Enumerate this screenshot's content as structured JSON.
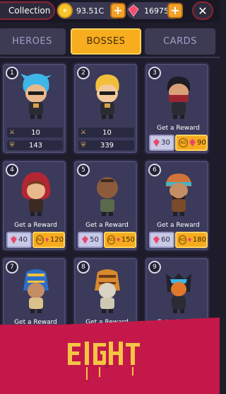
{
  "topbar": {
    "collection_label": "Collection",
    "coins": "93.51C",
    "gems": "16975",
    "plus_label": "+",
    "close_label": "✕"
  },
  "tabs": [
    {
      "label": "HEROES",
      "active": false
    },
    {
      "label": "BOSSES",
      "active": true
    },
    {
      "label": "CARDS",
      "active": false
    }
  ],
  "bosses": [
    {
      "num": "1",
      "sword": "10",
      "shield": "143"
    },
    {
      "num": "2",
      "sword": "10",
      "shield": "339"
    },
    {
      "num": "3",
      "reward_text": "Get a Reward",
      "gem_cost": "30",
      "ad_reward": "90"
    },
    {
      "num": "4",
      "reward_text": "Get a Reward",
      "gem_cost": "40",
      "ad_reward": "120"
    },
    {
      "num": "5",
      "reward_text": "Get a Reward",
      "gem_cost": "50",
      "ad_reward": "150"
    },
    {
      "num": "6",
      "reward_text": "Get a Reward",
      "gem_cost": "60",
      "ad_reward": "180"
    },
    {
      "num": "7",
      "reward_text": "Get a Reward"
    },
    {
      "num": "8",
      "reward_text": "Get a Reward"
    },
    {
      "num": "9",
      "reward_text": "Get a Reward"
    }
  ],
  "icons": {
    "coin": "coin-icon",
    "gem": "gem-icon",
    "sword": "sword-icon",
    "shield": "shield-icon",
    "ad": "ad-icon",
    "close": "close-icon"
  },
  "colors": {
    "accent": "#f7ad1d",
    "banner": "#c4184a",
    "card_bg": "#3b3a5a",
    "page_bg": "#1e1c2b"
  },
  "banner": {
    "ad_label": "AD",
    "bottom_text": "G"
  }
}
